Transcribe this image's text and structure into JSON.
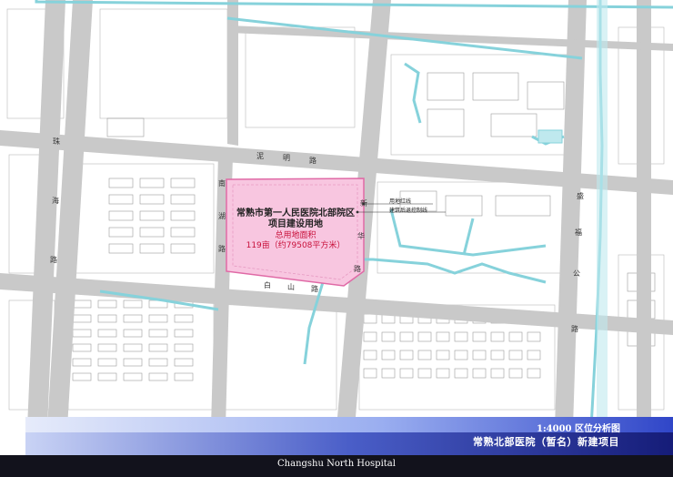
{
  "colors": {
    "road": "#c9c9c9",
    "water": "#a5dfe6",
    "site_fill": "#f8c6e0",
    "site_border": "#e06aa6",
    "banner_dark": "#1a1e8a",
    "banner_light": "#a9b8f0",
    "footer": "#12121c"
  },
  "site": {
    "name_line1": "常熟市第一人民医院北部院区",
    "name_line2": "项目建设用地",
    "area_label": "总用地面积",
    "area_value": "119亩（约79508平方米）"
  },
  "roads": {
    "north_chars": [
      "泥",
      "明",
      "路"
    ],
    "south_chars": [
      "白",
      "山",
      "路"
    ],
    "west_chars": [
      "南",
      "湖",
      "路"
    ],
    "east_chars": [
      "新",
      "华",
      "路"
    ],
    "far_west_chars": [
      "珠",
      "海",
      "路"
    ],
    "far_east_chars": [
      "盛",
      "福",
      "公",
      "路"
    ]
  },
  "legend": {
    "red_line": "用地红线",
    "build_line": "建筑后退控制线"
  },
  "banner": {
    "scale_title": "1:4000   区位分析图",
    "project_title": "常熟北部医院（暂名）新建项目"
  },
  "footer": {
    "english": "Changshu North Hospital"
  }
}
